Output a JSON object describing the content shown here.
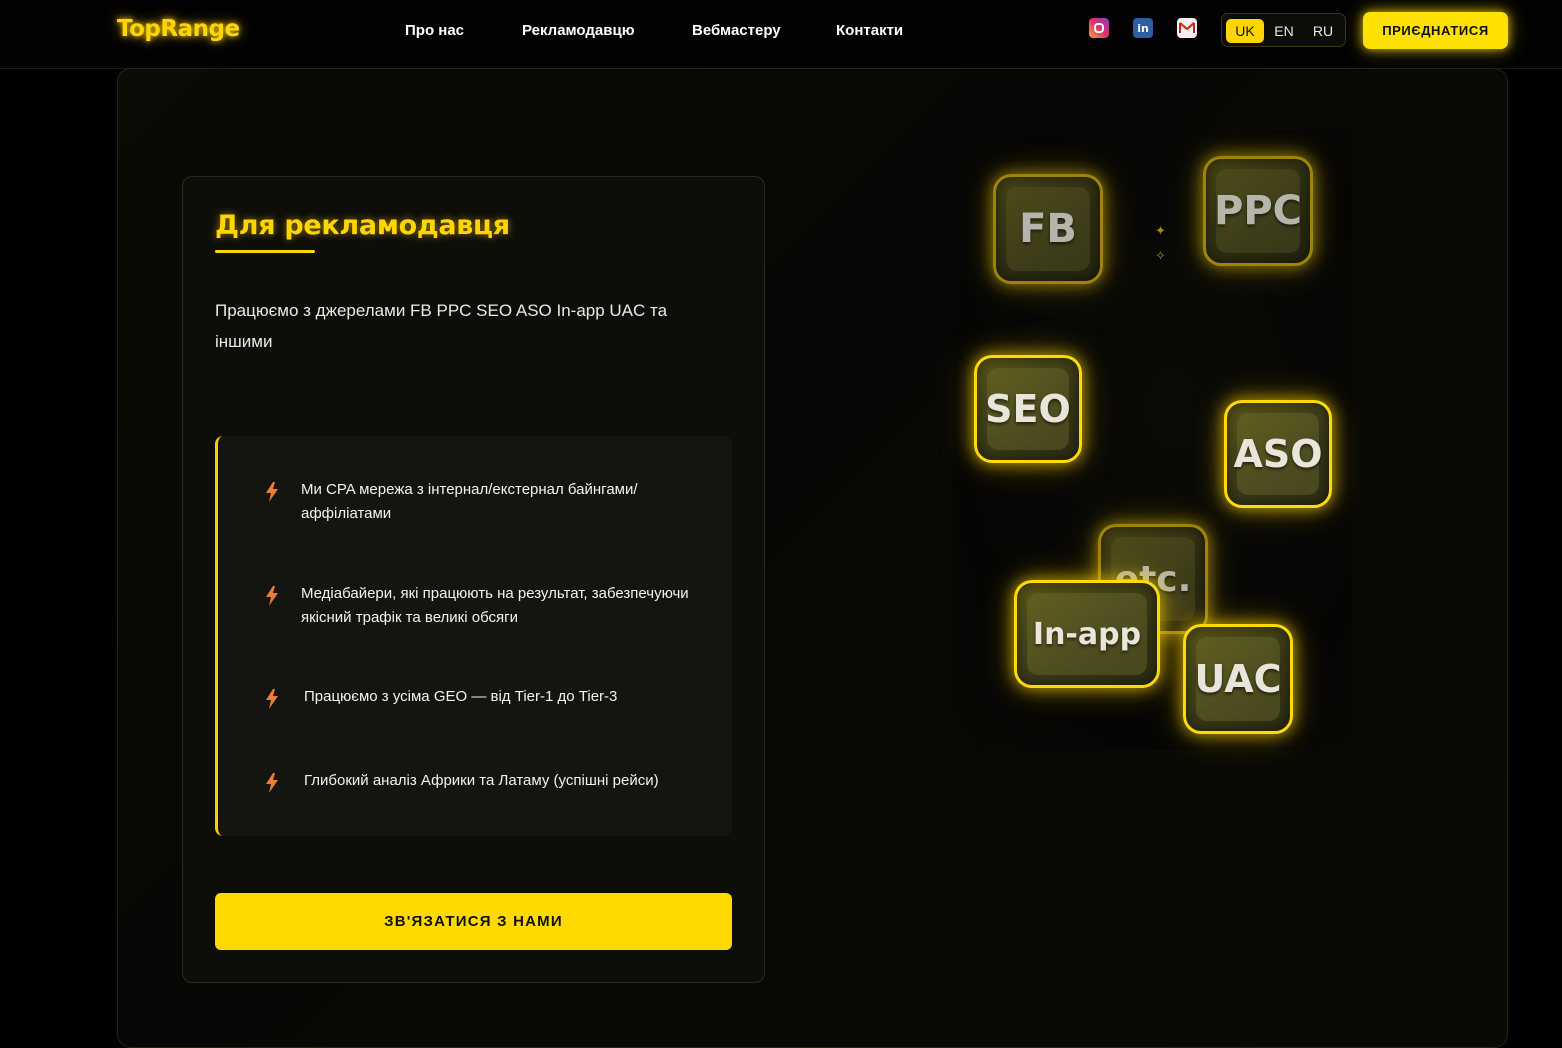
{
  "header": {
    "logo": "TopRange",
    "nav": [
      "Про нас",
      "Рекламодавцю",
      "Вебмастеру",
      "Контакти"
    ],
    "socials": [
      {
        "icon": "instagram-icon",
        "label": ""
      },
      {
        "icon": "linkedin-icon",
        "label": "in"
      },
      {
        "icon": "gmail-icon",
        "label": ""
      }
    ],
    "languages": [
      "UK",
      "EN",
      "RU"
    ],
    "active_language": "UK",
    "join_label": "ПРИЄДНАТИСЯ"
  },
  "card": {
    "title": "Для рекламодавця",
    "description": "Працюємо з джерелами FB PPC SEO ASO In-app UAC та іншими",
    "features": [
      "Ми CPA мережа з інтернал/екстернал байнгами/аффіліатами",
      "Медіабайери, які працюють на результат, забезпечуючи якісний трафік та великі обсяги",
      "Працюємо з усіма GEO — від Tier-1 до Tier-3",
      "Глибокий аналіз Африки та Латаму (успішні рейси)"
    ],
    "cta_label": "ЗВ'ЯЗАТИСЯ З НАМИ"
  },
  "graphic": {
    "tiles": [
      "FB",
      "PPC",
      "SEO",
      "ASO",
      "etc.",
      "In-app",
      "UAC"
    ]
  },
  "colors": {
    "accent": "#ffd500",
    "background": "#000000"
  }
}
